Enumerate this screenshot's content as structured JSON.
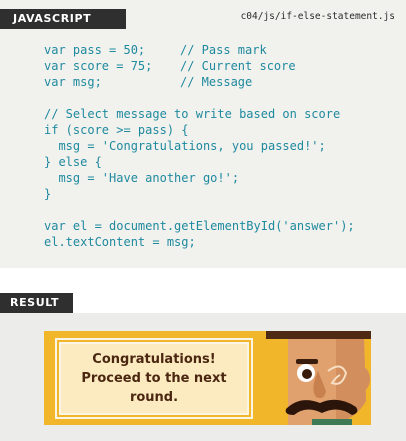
{
  "code_panel": {
    "language_label": "JAVASCRIPT",
    "file_path": "c04/js/if-else-statement.js",
    "lines": [
      {
        "code": "var pass = 50;",
        "comment": "// Pass mark"
      },
      {
        "code": "var score = 75;",
        "comment": "// Current score"
      },
      {
        "code": "var msg;",
        "comment": "// Message"
      },
      {
        "code": "",
        "comment": ""
      },
      {
        "code": "// Select message to write based on score",
        "comment": ""
      },
      {
        "code": "if (score >= pass) {",
        "comment": ""
      },
      {
        "code": "  msg = 'Congratulations, you passed!';",
        "comment": ""
      },
      {
        "code": "} else {",
        "comment": ""
      },
      {
        "code": "  msg = 'Have another go!';",
        "comment": ""
      },
      {
        "code": "}",
        "comment": ""
      },
      {
        "code": "",
        "comment": ""
      },
      {
        "code": "var el = document.getElementById('answer');",
        "comment": ""
      },
      {
        "code": "el.textContent = msg;",
        "comment": ""
      }
    ]
  },
  "result": {
    "label": "RESULT",
    "message": "Congratulations! Proceed to the next round.",
    "colors": {
      "banner": "#f1b629",
      "message_box": "#fcebc0",
      "text": "#4b2711"
    }
  },
  "colors": {
    "code_text": "#1f8a9e",
    "tab_background": "#2f2f2f",
    "code_background": "#f1f1ee"
  }
}
